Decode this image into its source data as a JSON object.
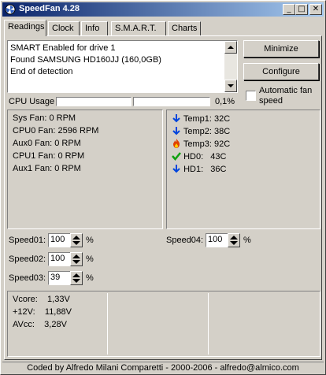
{
  "window": {
    "title": "SpeedFan 4.28"
  },
  "tabs": [
    "Readings",
    "Clock",
    "Info",
    "S.M.A.R.T.",
    "Charts"
  ],
  "log": {
    "lines": [
      "SMART Enabled for drive 1",
      "Found SAMSUNG HD160JJ (160,0GB)",
      "End of detection"
    ]
  },
  "buttons": {
    "minimize": "Minimize",
    "configure": "Configure"
  },
  "auto_fan": {
    "label_line1": "Automatic fan",
    "label_line2": "speed",
    "checked": false
  },
  "cpu_usage": {
    "label": "CPU Usage",
    "value": "0,1%"
  },
  "fans": [
    {
      "label": "Sys Fan:",
      "value": "0 RPM"
    },
    {
      "label": "CPU0 Fan:",
      "value": "2596 RPM"
    },
    {
      "label": "Aux0 Fan:",
      "value": "0 RPM"
    },
    {
      "label": "CPU1 Fan:",
      "value": "0 RPM"
    },
    {
      "label": "Aux1 Fan:",
      "value": "0 RPM"
    }
  ],
  "temps": [
    {
      "label": "Temp1:",
      "value": "32C",
      "icon": "down-arrow-icon"
    },
    {
      "label": "Temp2:",
      "value": "38C",
      "icon": "down-arrow-icon"
    },
    {
      "label": "Temp3:",
      "value": "92C",
      "icon": "flame-icon"
    },
    {
      "label": "HD0:",
      "value": "43C",
      "icon": "checkmark-icon"
    },
    {
      "label": "HD1:",
      "value": "36C",
      "icon": "down-arrow-icon"
    }
  ],
  "speeds": [
    {
      "label": "Speed01:",
      "value": "100",
      "unit": "%"
    },
    {
      "label": "Speed02:",
      "value": "100",
      "unit": "%"
    },
    {
      "label": "Speed03:",
      "value": "39",
      "unit": "%"
    },
    {
      "label": "Speed04:",
      "value": "100",
      "unit": "%"
    }
  ],
  "voltages": [
    {
      "label": "Vcore:",
      "value": "1,33V"
    },
    {
      "label": "+12V:",
      "value": "11,88V"
    },
    {
      "label": "AVcc:",
      "value": "3,28V"
    }
  ],
  "statusbar": {
    "text": "Coded by Alfredo Milani Comparetti - 2000-2006 - alfredo@almico.com"
  },
  "colors": {
    "title_start": "#0a246a",
    "title_end": "#a6caf0",
    "face": "#d4d0c8",
    "arrow_blue": "#0044dd",
    "flame": "#e04000",
    "check_green": "#10a010"
  }
}
